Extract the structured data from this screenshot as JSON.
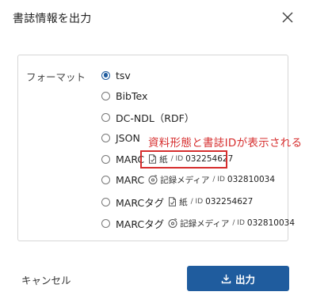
{
  "dialog": {
    "title": "書誌情報を出力",
    "close_icon": "close-icon"
  },
  "format": {
    "label": "フォーマット",
    "selected": "tsv",
    "options": [
      {
        "label": "tsv"
      },
      {
        "label": "BibTex"
      },
      {
        "label": "DC-NDL（RDF）"
      },
      {
        "label": "JSON"
      },
      {
        "label": "MARC",
        "medium_icon": "paper-icon",
        "medium": "紙",
        "id_label": "/ ID",
        "id": "032254627"
      },
      {
        "label": "MARC",
        "medium_icon": "disc-icon",
        "medium": "記録メディア",
        "id_label": "/ ID",
        "id": "032810034"
      },
      {
        "label": "MARCタグ",
        "medium_icon": "paper-icon",
        "medium": "紙",
        "id_label": "/ ID",
        "id": "032254627"
      },
      {
        "label": "MARCタグ",
        "medium_icon": "disc-icon",
        "medium": "記録メディア",
        "id_label": "/ ID",
        "id": "032810034"
      }
    ]
  },
  "annotation": {
    "text": "資料形態と書誌IDが表示される",
    "color": "#d62d2d"
  },
  "footer": {
    "cancel_label": "キャンセル",
    "output_label": "出力",
    "output_icon": "download-icon"
  },
  "colors": {
    "accent": "#1f5c9e",
    "border": "#d6d6d6",
    "highlight": "#d62d2d"
  }
}
